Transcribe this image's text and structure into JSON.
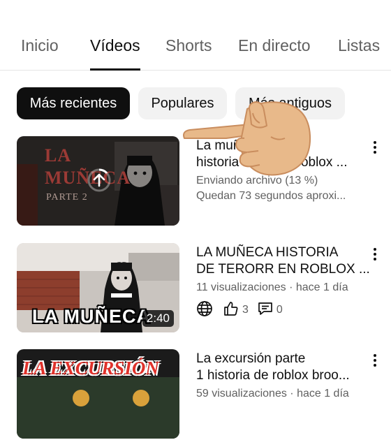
{
  "tabs": [
    {
      "label": "Inicio",
      "active": false
    },
    {
      "label": "Vídeos",
      "active": true
    },
    {
      "label": "Shorts",
      "active": false
    },
    {
      "label": "En directo",
      "active": false
    },
    {
      "label": "Listas",
      "active": false
    }
  ],
  "chips": [
    {
      "label": "Más recientes",
      "selected": true
    },
    {
      "label": "Populares",
      "selected": false
    },
    {
      "label": "Más antiguos",
      "selected": false
    }
  ],
  "videos": [
    {
      "title_line1": "La muñeca historia",
      "title_line2": "historia de terror roblox ...",
      "status": "Enviando archivo (13 %)",
      "remaining": "Quedan 73 segundos aproxi...",
      "upload_progress_percent": 13,
      "thumb_text": "LA MUÑECA",
      "thumb_subtext": "PARTE 2"
    },
    {
      "title_line1": "LA MUÑECA HISTORIA",
      "title_line2": "DE TERORR EN ROBLOX ...",
      "meta": "11 visualizaciones · hace 1 día",
      "duration": "2:40",
      "likes": "3",
      "comments": "0",
      "thumb_text": "LA MUÑECA"
    },
    {
      "title_line1": "La excursión parte",
      "title_line2": "1 historia de roblox broo...",
      "meta": "59 visualizaciones · hace 1 día",
      "thumb_text": "LA EXCURSIÓN"
    }
  ],
  "colors": {
    "accent": "#0f0f0f",
    "secondary_text": "#606060",
    "chip_bg": "#f2f2f2"
  },
  "icons": [
    "upload-icon",
    "globe-icon",
    "thumbs-up-icon",
    "comment-icon",
    "more-vert-icon",
    "pointing-hand-icon"
  ]
}
